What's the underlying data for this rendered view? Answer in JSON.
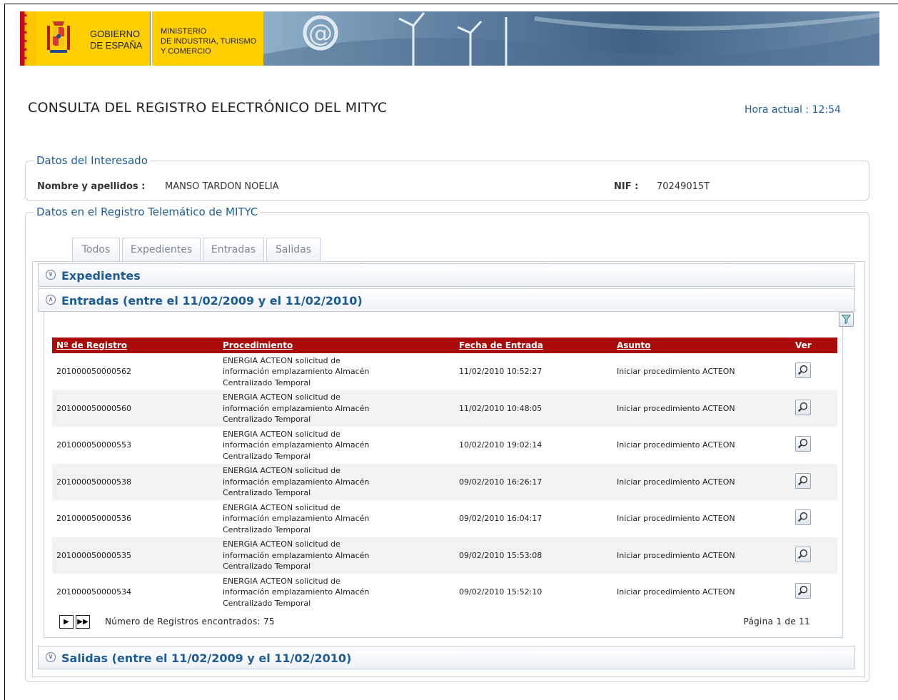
{
  "header": {
    "gov_line1": "GOBIERNO",
    "gov_line2": "DE ESPAÑA",
    "ministry_line1": "MINISTERIO",
    "ministry_line2": "DE INDUSTRIA, TURISMO",
    "ministry_line3": "Y COMERCIO"
  },
  "page_title": "CONSULTA DEL REGISTRO ELECTRÓNICO DEL MITYC",
  "clock": "Hora actual : 12:54",
  "interesado": {
    "legend": "Datos del Interesado",
    "name_label": "Nombre y apellidos :",
    "name_value": "MANSO TARDON NOELIA",
    "nif_label": "NIF :",
    "nif_value": "70249015T"
  },
  "registro": {
    "legend": "Datos en el Registro Telemático de MITYC",
    "tabs": [
      "Todos",
      "Expedientes",
      "Entradas",
      "Salidas"
    ]
  },
  "panels": {
    "expedientes": "Expedientes",
    "entradas": "Entradas (entre el 11/02/2009 y el 11/02/2010)",
    "salidas": "Salidas (entre el 11/02/2009 y el 11/02/2010)"
  },
  "table": {
    "headers": [
      "Nº de Registro",
      "Procedimiento",
      "Fecha de Entrada",
      "Asunto",
      "Ver"
    ],
    "rows": [
      {
        "registro": "201000050000562",
        "proc1": "ENERGIA ACTEON solicitud de",
        "proc2": "información emplazamiento Almacén",
        "proc3": "Centralizado Temporal",
        "fecha": "11/02/2010 10:52:27",
        "asunto": "Iniciar procedimiento ACTEON"
      },
      {
        "registro": "201000050000560",
        "proc1": "ENERGIA ACTEON solicitud de",
        "proc2": "información emplazamiento Almacén",
        "proc3": "Centralizado Temporal",
        "fecha": "11/02/2010 10:48:05",
        "asunto": "Iniciar procedimiento ACTEON"
      },
      {
        "registro": "201000050000553",
        "proc1": "ENERGIA ACTEON solicitud de",
        "proc2": "información emplazamiento Almacén",
        "proc3": "Centralizado Temporal",
        "fecha": "10/02/2010 19:02:14",
        "asunto": "Iniciar procedimiento ACTEON"
      },
      {
        "registro": "201000050000538",
        "proc1": "ENERGIA ACTEON solicitud de",
        "proc2": "información emplazamiento Almacén",
        "proc3": "Centralizado Temporal",
        "fecha": "09/02/2010 16:26:17",
        "asunto": "Iniciar procedimiento ACTEON"
      },
      {
        "registro": "201000050000536",
        "proc1": "ENERGIA ACTEON solicitud de",
        "proc2": "información emplazamiento Almacén",
        "proc3": "Centralizado Temporal",
        "fecha": "09/02/2010 16:04:17",
        "asunto": "Iniciar procedimiento ACTEON"
      },
      {
        "registro": "201000050000535",
        "proc1": "ENERGIA ACTEON solicitud de",
        "proc2": "información emplazamiento Almacén",
        "proc3": "Centralizado Temporal",
        "fecha": "09/02/2010 15:53:08",
        "asunto": "Iniciar procedimiento ACTEON"
      },
      {
        "registro": "201000050000534",
        "proc1": "ENERGIA ACTEON solicitud de",
        "proc2": "información emplazamiento Almacén",
        "proc3": "Centralizado Temporal",
        "fecha": "09/02/2010 15:52:10",
        "asunto": "Iniciar procedimiento ACTEON"
      }
    ]
  },
  "pager": {
    "count": "Número de Registros encontrados: 75",
    "page": "Página 1 de 11"
  },
  "colors": {
    "accent_blue": "#1e5c96",
    "table_header": "#a90b0b",
    "banner_yellow": "#ffcf00"
  },
  "icons": {
    "view": "magnifier-icon",
    "filter": "filter-icon",
    "next": "next-page-icon",
    "last": "last-page-icon",
    "expand": "chevron-down-icon",
    "collapse": "chevron-up-icon"
  }
}
